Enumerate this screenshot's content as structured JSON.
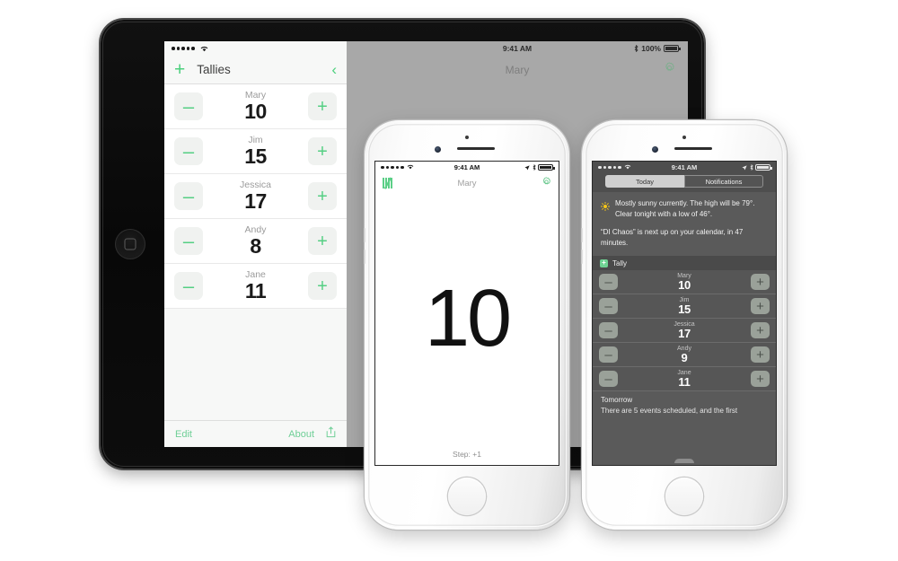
{
  "ipad": {
    "status": {
      "carrier_dots": 5,
      "wifi": "wifi-icon"
    },
    "master": {
      "add_label": "+",
      "title": "Tallies",
      "back_label": "‹",
      "rows": [
        {
          "name": "Mary",
          "count": "10",
          "minus": "–",
          "plus": "+"
        },
        {
          "name": "Jim",
          "count": "15",
          "minus": "–",
          "plus": "+"
        },
        {
          "name": "Jessica",
          "count": "17",
          "minus": "–",
          "plus": "+"
        },
        {
          "name": "Andy",
          "count": "8",
          "minus": "–",
          "plus": "+"
        },
        {
          "name": "Jane",
          "count": "11",
          "minus": "–",
          "plus": "+"
        }
      ],
      "toolbar": {
        "edit": "Edit",
        "about": "About",
        "share": "share-icon"
      }
    },
    "detail": {
      "time": "9:41 AM",
      "battery_percent": "100%",
      "bluetooth": "bluetooth-icon",
      "title": "Mary",
      "gear": "gear-icon"
    }
  },
  "phone_center": {
    "status": {
      "time": "9:41 AM",
      "carrier_dots": 5
    },
    "nav": {
      "tally_icon": "tally-marks-icon",
      "title": "Mary",
      "gear": "gear-icon"
    },
    "big_count": "10",
    "footer": "Step: +1"
  },
  "phone_right": {
    "status": {
      "time": "9:41 AM",
      "carrier_dots": 5
    },
    "tabs": [
      {
        "label": "Today",
        "selected": true
      },
      {
        "label": "Notifications",
        "selected": false
      }
    ],
    "today": {
      "weather_icon": "sun-icon",
      "weather_text": "Mostly sunny currently. The high will be 79°. Clear tonight with a low of 46°.",
      "calendar_text": "“DI Chaos” is next up on your calendar, in 47 minutes."
    },
    "tally_widget": {
      "section_title": "Tally",
      "badge": "+",
      "rows": [
        {
          "name": "Mary",
          "count": "10",
          "minus": "–",
          "plus": "+"
        },
        {
          "name": "Jim",
          "count": "15",
          "minus": "–",
          "plus": "+"
        },
        {
          "name": "Jessica",
          "count": "17",
          "minus": "–",
          "plus": "+"
        },
        {
          "name": "Andy",
          "count": "9",
          "minus": "–",
          "plus": "+"
        },
        {
          "name": "Jane",
          "count": "11",
          "minus": "–",
          "plus": "+"
        }
      ]
    },
    "tomorrow": {
      "title": "Tomorrow",
      "body": "There are 5 events scheduled, and the first"
    }
  },
  "colors": {
    "accent_green": "#5ccf87",
    "ipad_screen_dim": "#a8a8a8",
    "nc_background": "#4e4e4e"
  }
}
